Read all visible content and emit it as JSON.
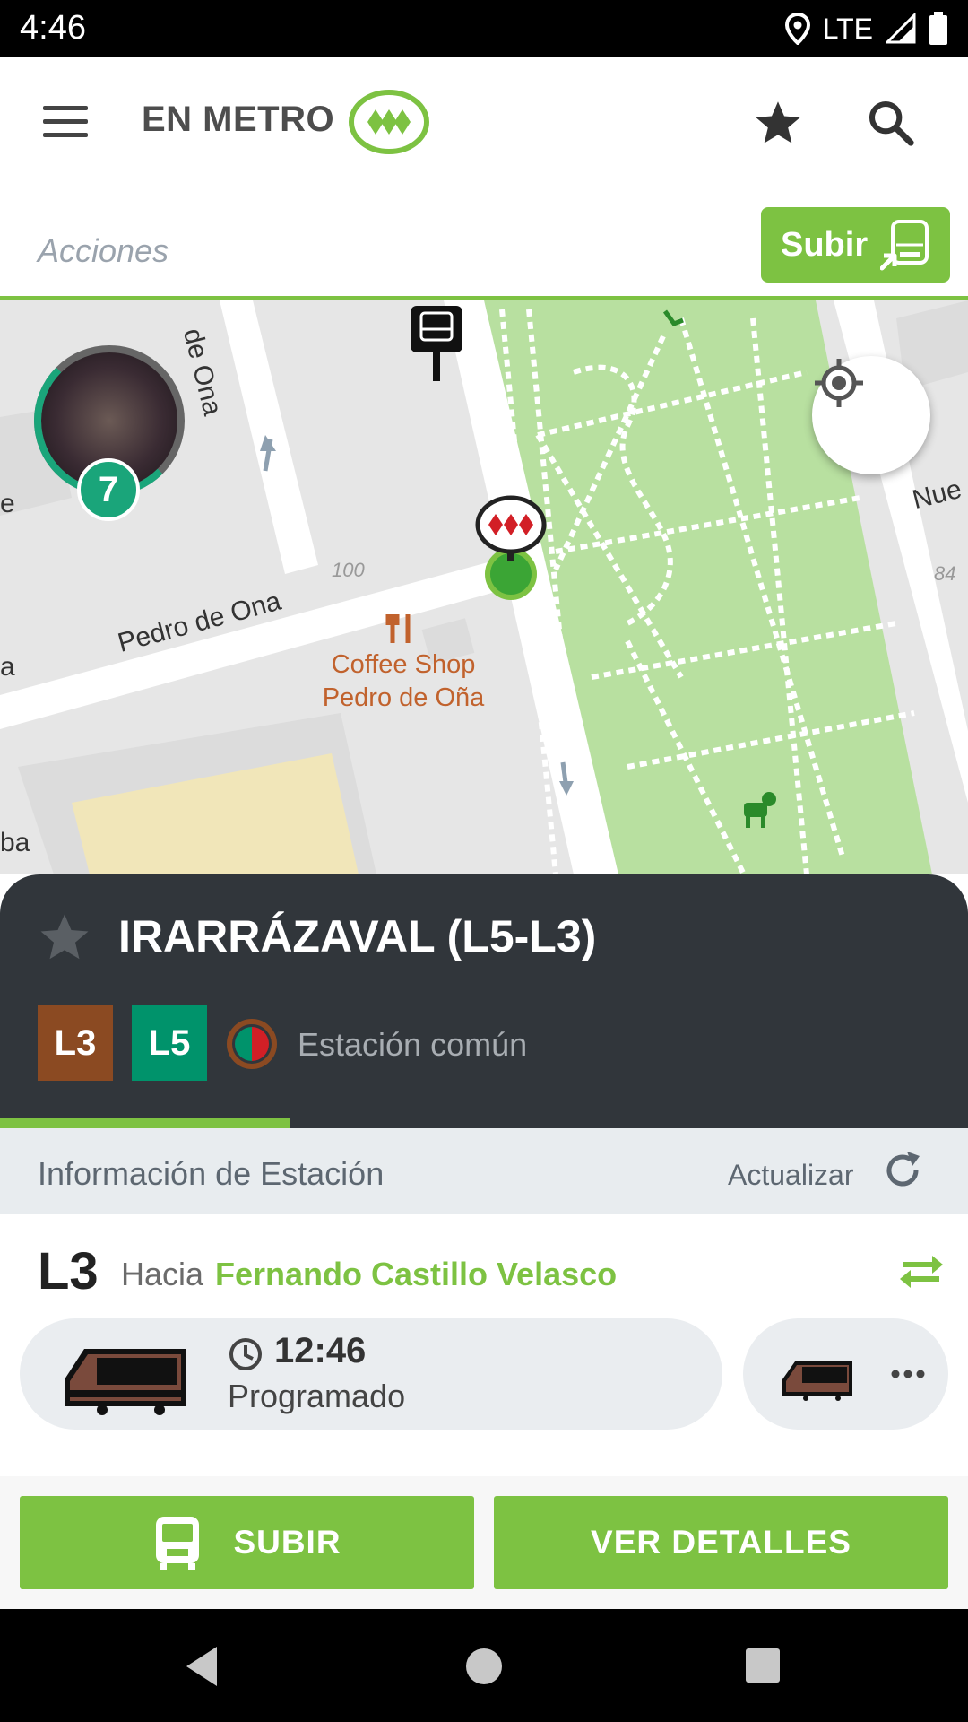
{
  "status_bar": {
    "time": "4:46",
    "network": "LTE"
  },
  "header": {
    "title": "EN METRO",
    "menu_icon": "menu-icon",
    "favorite_icon": "star-icon",
    "search_icon": "search-icon"
  },
  "actions": {
    "label": "Acciones",
    "board_button": "Subir"
  },
  "map": {
    "streets": [
      "de Ona",
      "Pedro de Ona",
      "Nue",
      "e",
      "a",
      "ba"
    ],
    "poi": {
      "name_line1": "Coffee Shop",
      "name_line2": "Pedro de Oña"
    },
    "numbers": [
      "100",
      "84"
    ],
    "group_badge": "7"
  },
  "station": {
    "name": "IRARRÁZAVAL (L5-L3)",
    "lines": [
      {
        "label": "L3",
        "color": "#8b4a22"
      },
      {
        "label": "L5",
        "color": "#00936b"
      }
    ],
    "common_label": "Estación común",
    "progress": 0.3
  },
  "info": {
    "title": "Información de Estación",
    "refresh_label": "Actualizar",
    "direction": {
      "line": "L3",
      "toward_label": "Hacia",
      "destination": "Fernando Castillo Velasco"
    },
    "next_train": {
      "time": "12:46",
      "status": "Programado"
    }
  },
  "buttons": {
    "board": "SUBIR",
    "details": "VER DETALLES"
  },
  "colors": {
    "accent": "#7dc242",
    "dark": "#31363b"
  }
}
